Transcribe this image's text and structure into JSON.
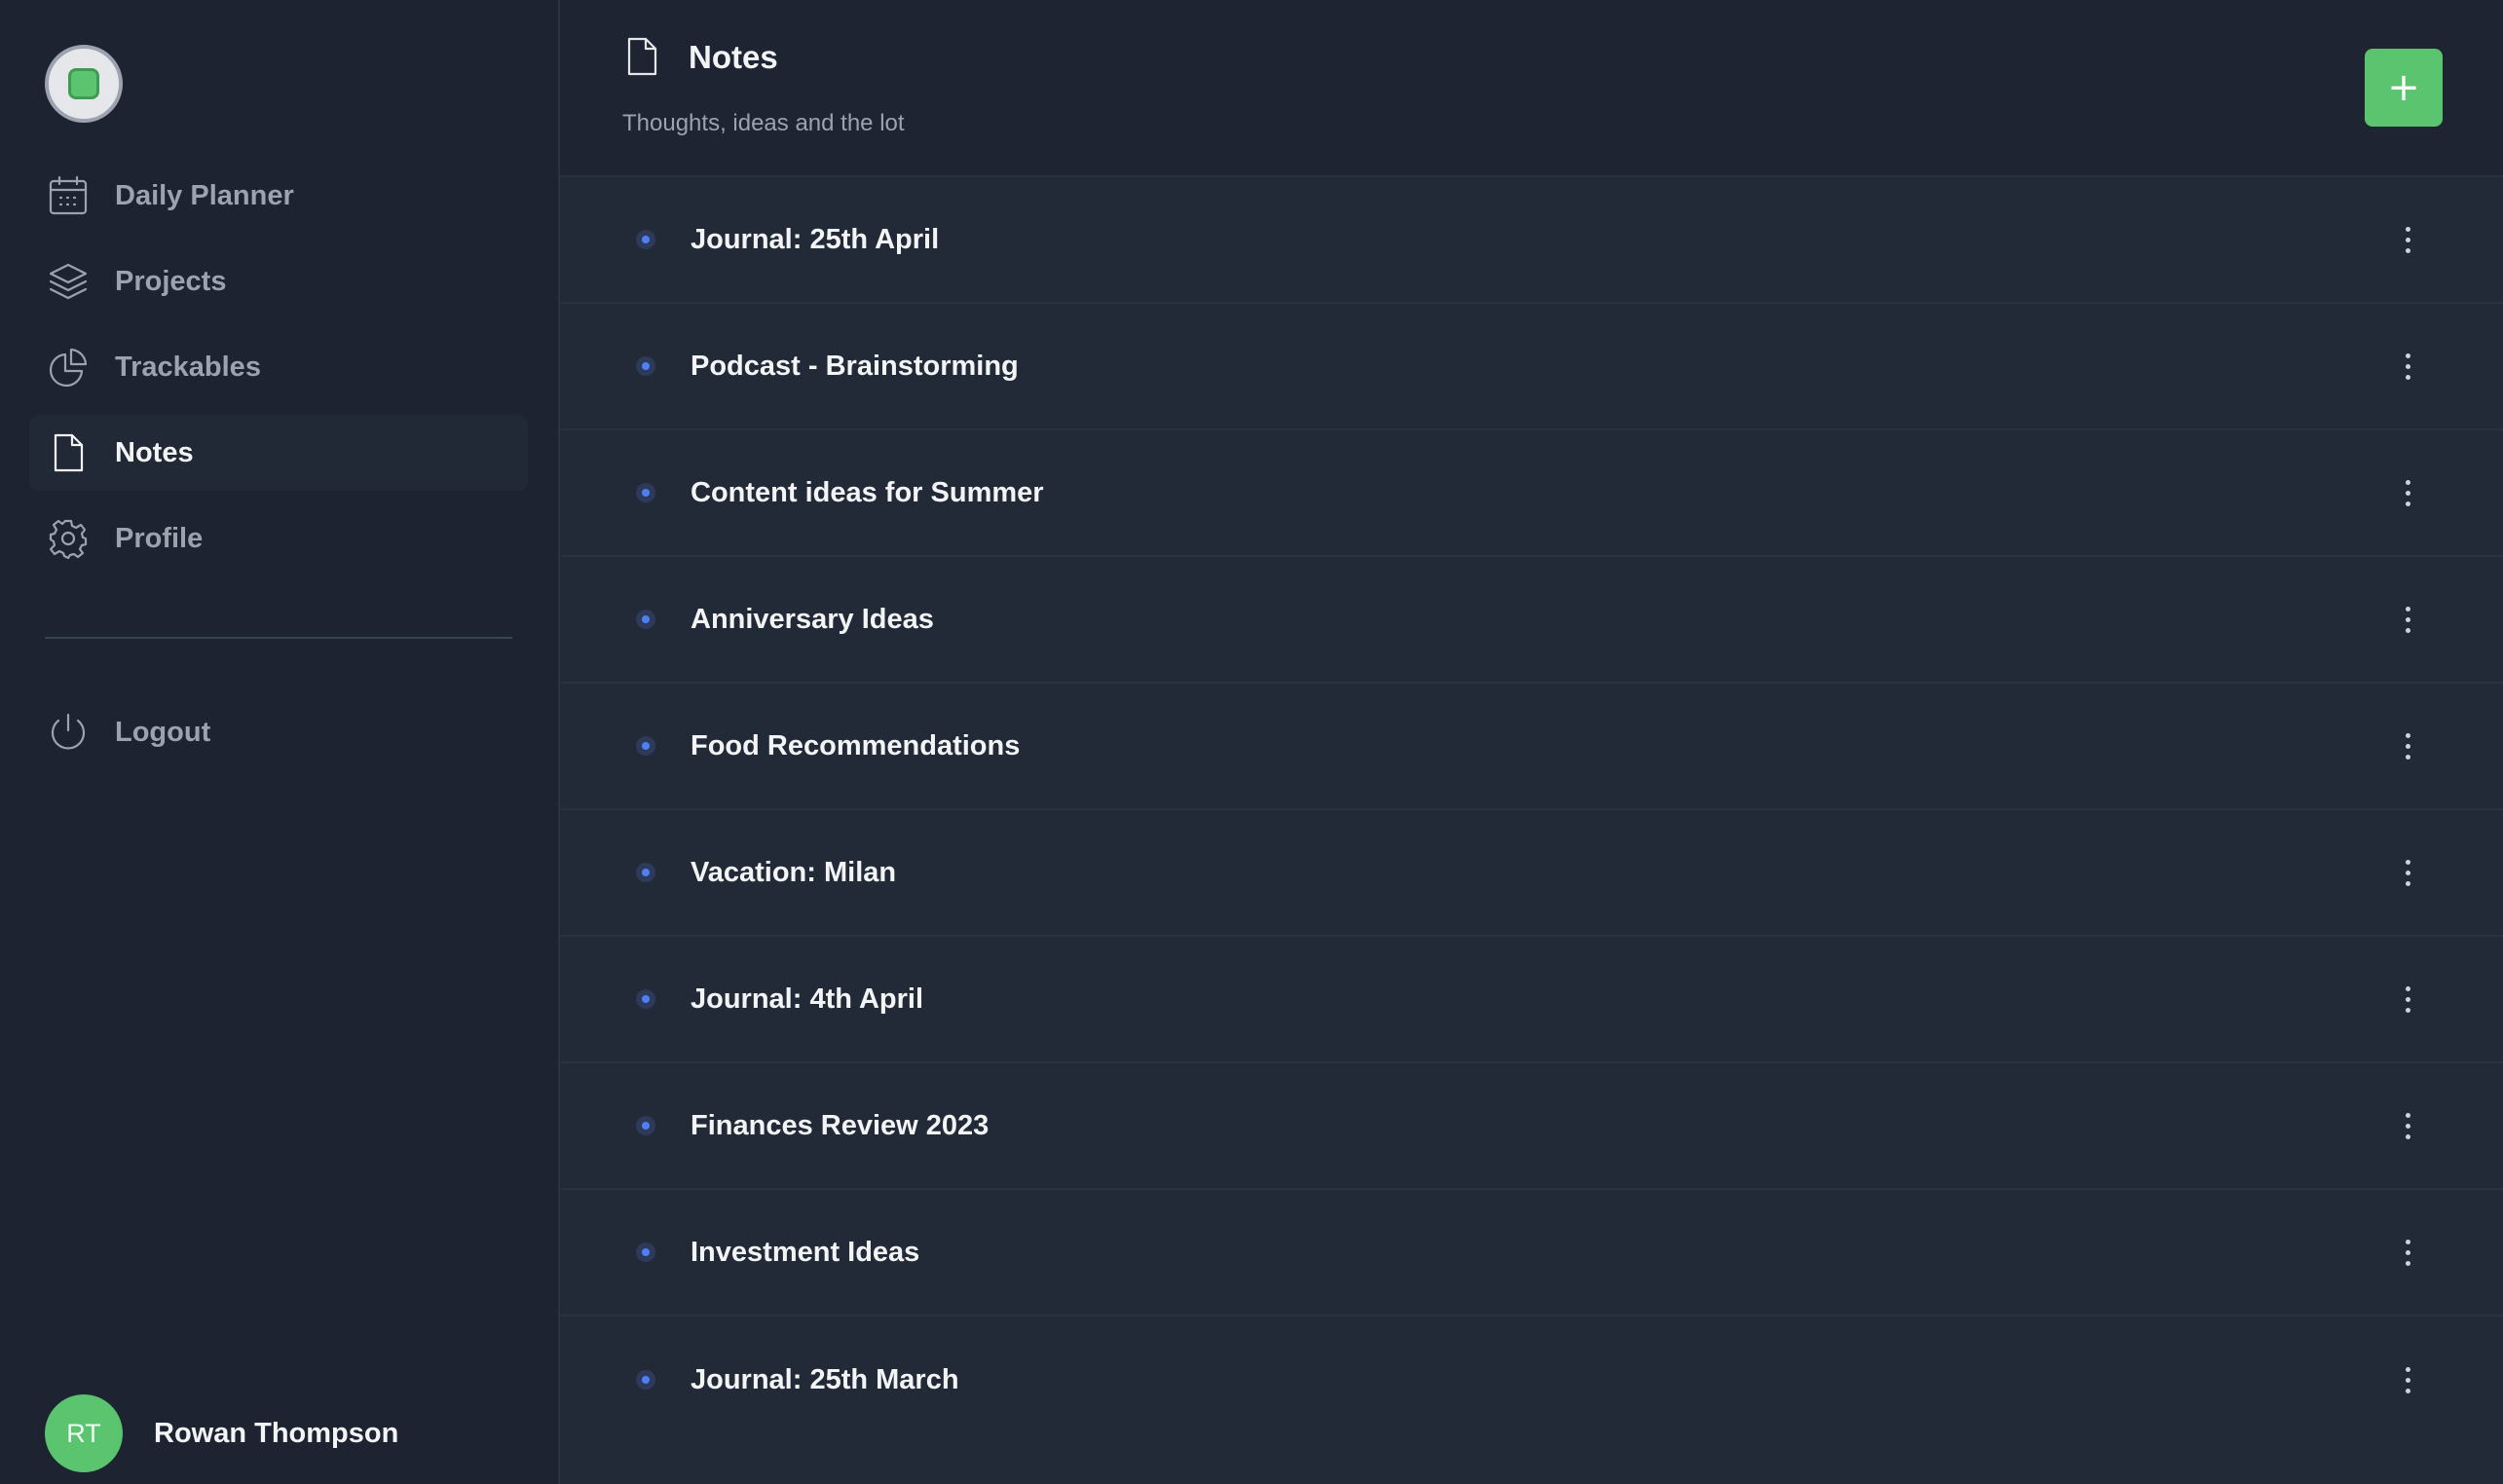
{
  "sidebar": {
    "nav": [
      {
        "label": "Daily Planner",
        "icon": "calendar-icon"
      },
      {
        "label": "Projects",
        "icon": "layers-icon"
      },
      {
        "label": "Trackables",
        "icon": "pie-chart-icon"
      },
      {
        "label": "Notes",
        "icon": "document-icon",
        "active": true
      },
      {
        "label": "Profile",
        "icon": "gear-icon"
      }
    ],
    "logout": {
      "label": "Logout",
      "icon": "power-icon"
    },
    "user": {
      "initials": "RT",
      "name": "Rowan Thompson"
    }
  },
  "header": {
    "title": "Notes",
    "subtitle": "Thoughts, ideas and the lot",
    "add_label": "+"
  },
  "notes": [
    {
      "title": "Journal: 25th April"
    },
    {
      "title": "Podcast - Brainstorming"
    },
    {
      "title": "Content ideas for Summer"
    },
    {
      "title": "Anniversary Ideas"
    },
    {
      "title": "Food Recommendations"
    },
    {
      "title": "Vacation: Milan"
    },
    {
      "title": "Journal: 4th April"
    },
    {
      "title": "Finances Review 2023"
    },
    {
      "title": "Investment Ideas"
    },
    {
      "title": "Journal: 25th March"
    }
  ],
  "colors": {
    "accent": "#5bc46e",
    "bullet": "#4f7ff0",
    "sidebar_bg": "#1d2330",
    "main_bg": "#222a38"
  }
}
